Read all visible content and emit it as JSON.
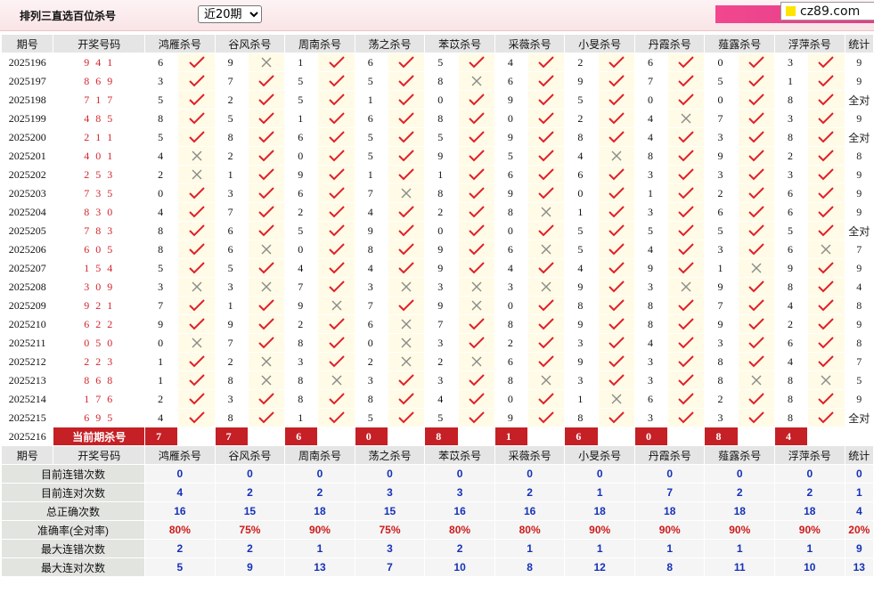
{
  "header": {
    "title": "排列三直选百位杀号",
    "period_select": "近20期",
    "brand": "cz89.com"
  },
  "columns": {
    "issue": "期号",
    "draw": "开奖号码",
    "predictors": [
      "鸿雁杀号",
      "谷风杀号",
      "周南杀号",
      "荡之杀号",
      "苯苡杀号",
      "采薇杀号",
      "小旻杀号",
      "丹霞杀号",
      "薤露杀号",
      "浮萍杀号"
    ],
    "count": "统计"
  },
  "rows": [
    {
      "issue": "2025196",
      "draw": "9 4 1",
      "picks": [
        "6",
        "9",
        "1",
        "6",
        "5",
        "4",
        "2",
        "6",
        "0",
        "3"
      ],
      "marks": [
        1,
        0,
        1,
        1,
        1,
        1,
        1,
        1,
        1,
        1
      ],
      "count": "9"
    },
    {
      "issue": "2025197",
      "draw": "8 6 9",
      "picks": [
        "3",
        "7",
        "5",
        "5",
        "8",
        "6",
        "9",
        "7",
        "5",
        "1"
      ],
      "marks": [
        1,
        1,
        1,
        1,
        0,
        1,
        1,
        1,
        1,
        1
      ],
      "count": "9"
    },
    {
      "issue": "2025198",
      "draw": "7 1 7",
      "picks": [
        "5",
        "2",
        "5",
        "1",
        "0",
        "9",
        "5",
        "0",
        "0",
        "8"
      ],
      "marks": [
        1,
        1,
        1,
        1,
        1,
        1,
        1,
        1,
        1,
        1
      ],
      "count": "全对"
    },
    {
      "issue": "2025199",
      "draw": "4 8 5",
      "picks": [
        "8",
        "5",
        "1",
        "6",
        "8",
        "0",
        "2",
        "4",
        "7",
        "3"
      ],
      "marks": [
        1,
        1,
        1,
        1,
        1,
        1,
        1,
        0,
        1,
        1
      ],
      "count": "9"
    },
    {
      "issue": "2025200",
      "draw": "2 1 1",
      "picks": [
        "5",
        "8",
        "6",
        "5",
        "5",
        "9",
        "8",
        "4",
        "3",
        "8"
      ],
      "marks": [
        1,
        1,
        1,
        1,
        1,
        1,
        1,
        1,
        1,
        1
      ],
      "count": "全对"
    },
    {
      "issue": "2025201",
      "draw": "4 0 1",
      "picks": [
        "4",
        "2",
        "0",
        "5",
        "9",
        "5",
        "4",
        "8",
        "9",
        "2"
      ],
      "marks": [
        0,
        1,
        1,
        1,
        1,
        1,
        0,
        1,
        1,
        1
      ],
      "count": "8"
    },
    {
      "issue": "2025202",
      "draw": "2 5 3",
      "picks": [
        "2",
        "1",
        "9",
        "1",
        "1",
        "6",
        "6",
        "3",
        "3",
        "3"
      ],
      "marks": [
        0,
        1,
        1,
        1,
        1,
        1,
        1,
        1,
        1,
        1
      ],
      "count": "9"
    },
    {
      "issue": "2025203",
      "draw": "7 3 5",
      "picks": [
        "0",
        "3",
        "6",
        "7",
        "8",
        "9",
        "0",
        "1",
        "2",
        "6"
      ],
      "marks": [
        1,
        1,
        1,
        0,
        1,
        1,
        1,
        1,
        1,
        1
      ],
      "count": "9"
    },
    {
      "issue": "2025204",
      "draw": "8 3 0",
      "picks": [
        "4",
        "7",
        "2",
        "4",
        "2",
        "8",
        "1",
        "3",
        "6",
        "6"
      ],
      "marks": [
        1,
        1,
        1,
        1,
        1,
        0,
        1,
        1,
        1,
        1
      ],
      "count": "9"
    },
    {
      "issue": "2025205",
      "draw": "7 8 3",
      "picks": [
        "8",
        "6",
        "5",
        "9",
        "0",
        "0",
        "5",
        "5",
        "5",
        "5"
      ],
      "marks": [
        1,
        1,
        1,
        1,
        1,
        1,
        1,
        1,
        1,
        1
      ],
      "count": "全对"
    },
    {
      "issue": "2025206",
      "draw": "6 0 5",
      "picks": [
        "8",
        "6",
        "0",
        "8",
        "9",
        "6",
        "5",
        "4",
        "3",
        "6"
      ],
      "marks": [
        1,
        0,
        1,
        1,
        1,
        0,
        1,
        1,
        1,
        0
      ],
      "count": "7"
    },
    {
      "issue": "2025207",
      "draw": "1 5 4",
      "picks": [
        "5",
        "5",
        "4",
        "4",
        "9",
        "4",
        "4",
        "9",
        "1",
        "9"
      ],
      "marks": [
        1,
        1,
        1,
        1,
        1,
        1,
        1,
        1,
        0,
        1
      ],
      "count": "9"
    },
    {
      "issue": "2025208",
      "draw": "3 0 9",
      "picks": [
        "3",
        "3",
        "7",
        "3",
        "3",
        "3",
        "9",
        "3",
        "9",
        "8"
      ],
      "marks": [
        0,
        0,
        1,
        0,
        0,
        0,
        1,
        0,
        1,
        1
      ],
      "count": "4"
    },
    {
      "issue": "2025209",
      "draw": "9 2 1",
      "picks": [
        "7",
        "1",
        "9",
        "7",
        "9",
        "0",
        "8",
        "8",
        "7",
        "4"
      ],
      "marks": [
        1,
        1,
        0,
        1,
        0,
        1,
        1,
        1,
        1,
        1
      ],
      "count": "8"
    },
    {
      "issue": "2025210",
      "draw": "6 2 2",
      "picks": [
        "9",
        "9",
        "2",
        "6",
        "7",
        "8",
        "9",
        "8",
        "9",
        "2"
      ],
      "marks": [
        1,
        1,
        1,
        0,
        1,
        1,
        1,
        1,
        1,
        1
      ],
      "count": "9"
    },
    {
      "issue": "2025211",
      "draw": "0 5 0",
      "picks": [
        "0",
        "7",
        "8",
        "0",
        "3",
        "2",
        "3",
        "4",
        "3",
        "6"
      ],
      "marks": [
        0,
        1,
        1,
        0,
        1,
        1,
        1,
        1,
        1,
        1
      ],
      "count": "8"
    },
    {
      "issue": "2025212",
      "draw": "2 2 3",
      "picks": [
        "1",
        "2",
        "3",
        "2",
        "2",
        "6",
        "9",
        "3",
        "8",
        "4"
      ],
      "marks": [
        1,
        0,
        1,
        0,
        0,
        1,
        1,
        1,
        1,
        1
      ],
      "count": "7"
    },
    {
      "issue": "2025213",
      "draw": "8 6 8",
      "picks": [
        "1",
        "8",
        "8",
        "3",
        "3",
        "8",
        "3",
        "3",
        "8",
        "8"
      ],
      "marks": [
        1,
        0,
        0,
        1,
        1,
        0,
        1,
        1,
        0,
        0
      ],
      "count": "5"
    },
    {
      "issue": "2025214",
      "draw": "1 7 6",
      "picks": [
        "2",
        "3",
        "8",
        "8",
        "4",
        "0",
        "1",
        "6",
        "2",
        "8"
      ],
      "marks": [
        1,
        1,
        1,
        1,
        1,
        1,
        0,
        1,
        1,
        1
      ],
      "count": "9"
    },
    {
      "issue": "2025215",
      "draw": "6 9 5",
      "picks": [
        "4",
        "8",
        "1",
        "5",
        "5",
        "9",
        "8",
        "3",
        "3",
        "8"
      ],
      "marks": [
        1,
        1,
        1,
        1,
        1,
        1,
        1,
        1,
        1,
        1
      ],
      "count": "全对"
    }
  ],
  "current": {
    "issue": "2025216",
    "label": "当前期杀号",
    "picks": [
      "7",
      "7",
      "6",
      "0",
      "8",
      "1",
      "6",
      "0",
      "8",
      "4"
    ]
  },
  "stats": [
    {
      "label": "目前连错次数",
      "values": [
        "0",
        "0",
        "0",
        "0",
        "0",
        "0",
        "0",
        "0",
        "0",
        "0"
      ],
      "count": "0",
      "red": false
    },
    {
      "label": "目前连对次数",
      "values": [
        "4",
        "2",
        "2",
        "3",
        "3",
        "2",
        "1",
        "7",
        "2",
        "2"
      ],
      "count": "1",
      "red": false
    },
    {
      "label": "总正确次数",
      "values": [
        "16",
        "15",
        "18",
        "15",
        "16",
        "16",
        "18",
        "18",
        "18",
        "18"
      ],
      "count": "4",
      "red": false
    },
    {
      "label": "准确率(全对率)",
      "values": [
        "80%",
        "75%",
        "90%",
        "75%",
        "80%",
        "80%",
        "90%",
        "90%",
        "90%",
        "90%"
      ],
      "count": "20%",
      "red": true
    },
    {
      "label": "最大连错次数",
      "values": [
        "2",
        "2",
        "1",
        "3",
        "2",
        "1",
        "1",
        "1",
        "1",
        "1"
      ],
      "count": "9",
      "red": false
    },
    {
      "label": "最大连对次数",
      "values": [
        "5",
        "9",
        "13",
        "7",
        "10",
        "8",
        "12",
        "8",
        "11",
        "10"
      ],
      "count": "13",
      "red": false
    }
  ],
  "colors": {
    "tick": "#e0202a",
    "cross": "#8a8a8a",
    "badge": "#c52025",
    "stat_blue": "#1531b8",
    "stat_red": "#d01a1a"
  }
}
